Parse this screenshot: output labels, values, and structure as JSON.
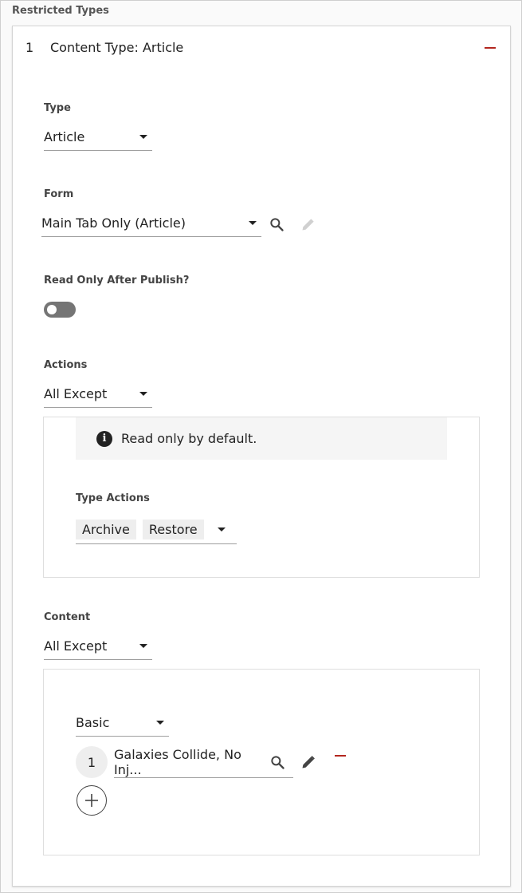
{
  "section_title": "Restricted Types",
  "item": {
    "index": "1",
    "title": "Content Type: Article",
    "remove_icon": "minus-icon"
  },
  "type_field": {
    "label": "Type",
    "value": "Article"
  },
  "form_field": {
    "label": "Form",
    "value": "Main Tab Only (Article)",
    "search_icon": "search-icon",
    "edit_icon": "pencil-icon",
    "edit_enabled": false
  },
  "read_only_field": {
    "label": "Read Only After Publish?",
    "checked": false
  },
  "actions_field": {
    "label": "Actions",
    "value": "All Except",
    "info_text": "Read only by default.",
    "info_icon": "info-icon",
    "type_actions_label": "Type Actions",
    "type_actions": [
      "Archive",
      "Restore"
    ]
  },
  "content_field": {
    "label": "Content",
    "value": "All Except",
    "group_select": "Basic",
    "entries": [
      {
        "index": "1",
        "title": "Galaxies Collide, No Inj..."
      }
    ],
    "add_icon": "plus-icon"
  },
  "colors": {
    "remove": "#b3261e",
    "toggle_off": "#757575",
    "chip_bg": "#eeeeee"
  }
}
